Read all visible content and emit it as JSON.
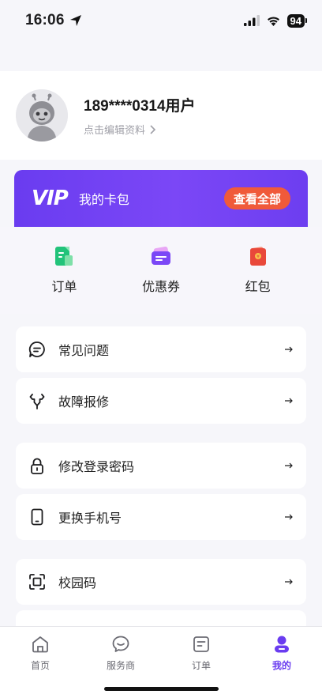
{
  "status_bar": {
    "time": "16:06",
    "battery": "94"
  },
  "profile": {
    "name": "189****0314用户",
    "edit_link": "点击编辑资料"
  },
  "vip": {
    "logo": "VIP",
    "title": "我的卡包",
    "view_all": "查看全部"
  },
  "quick_actions": [
    {
      "label": "订单",
      "icon": "order-doc-icon",
      "color": "#22c37a"
    },
    {
      "label": "优惠券",
      "icon": "coupon-icon",
      "color": "#7b47f6"
    },
    {
      "label": "红包",
      "icon": "red-envelope-icon",
      "color": "#e9483a"
    }
  ],
  "menu": [
    {
      "label": "常见问题",
      "icon": "faq-chat-icon"
    },
    {
      "label": "故障报修",
      "icon": "repair-wrench-icon"
    },
    {
      "label": "修改登录密码",
      "icon": "lock-icon"
    },
    {
      "label": "更换手机号",
      "icon": "phone-icon"
    },
    {
      "label": "校园码",
      "icon": "scan-frame-icon"
    }
  ],
  "bottom_nav": [
    {
      "label": "首页",
      "icon": "home-icon"
    },
    {
      "label": "服务商",
      "icon": "service-chat-icon"
    },
    {
      "label": "订单",
      "icon": "orders-icon"
    },
    {
      "label": "我的",
      "icon": "profile-icon",
      "active": true
    }
  ],
  "colors": {
    "accent": "#6a3cf0",
    "vip_button": "#f05a3a",
    "background": "#f6f6fa"
  }
}
